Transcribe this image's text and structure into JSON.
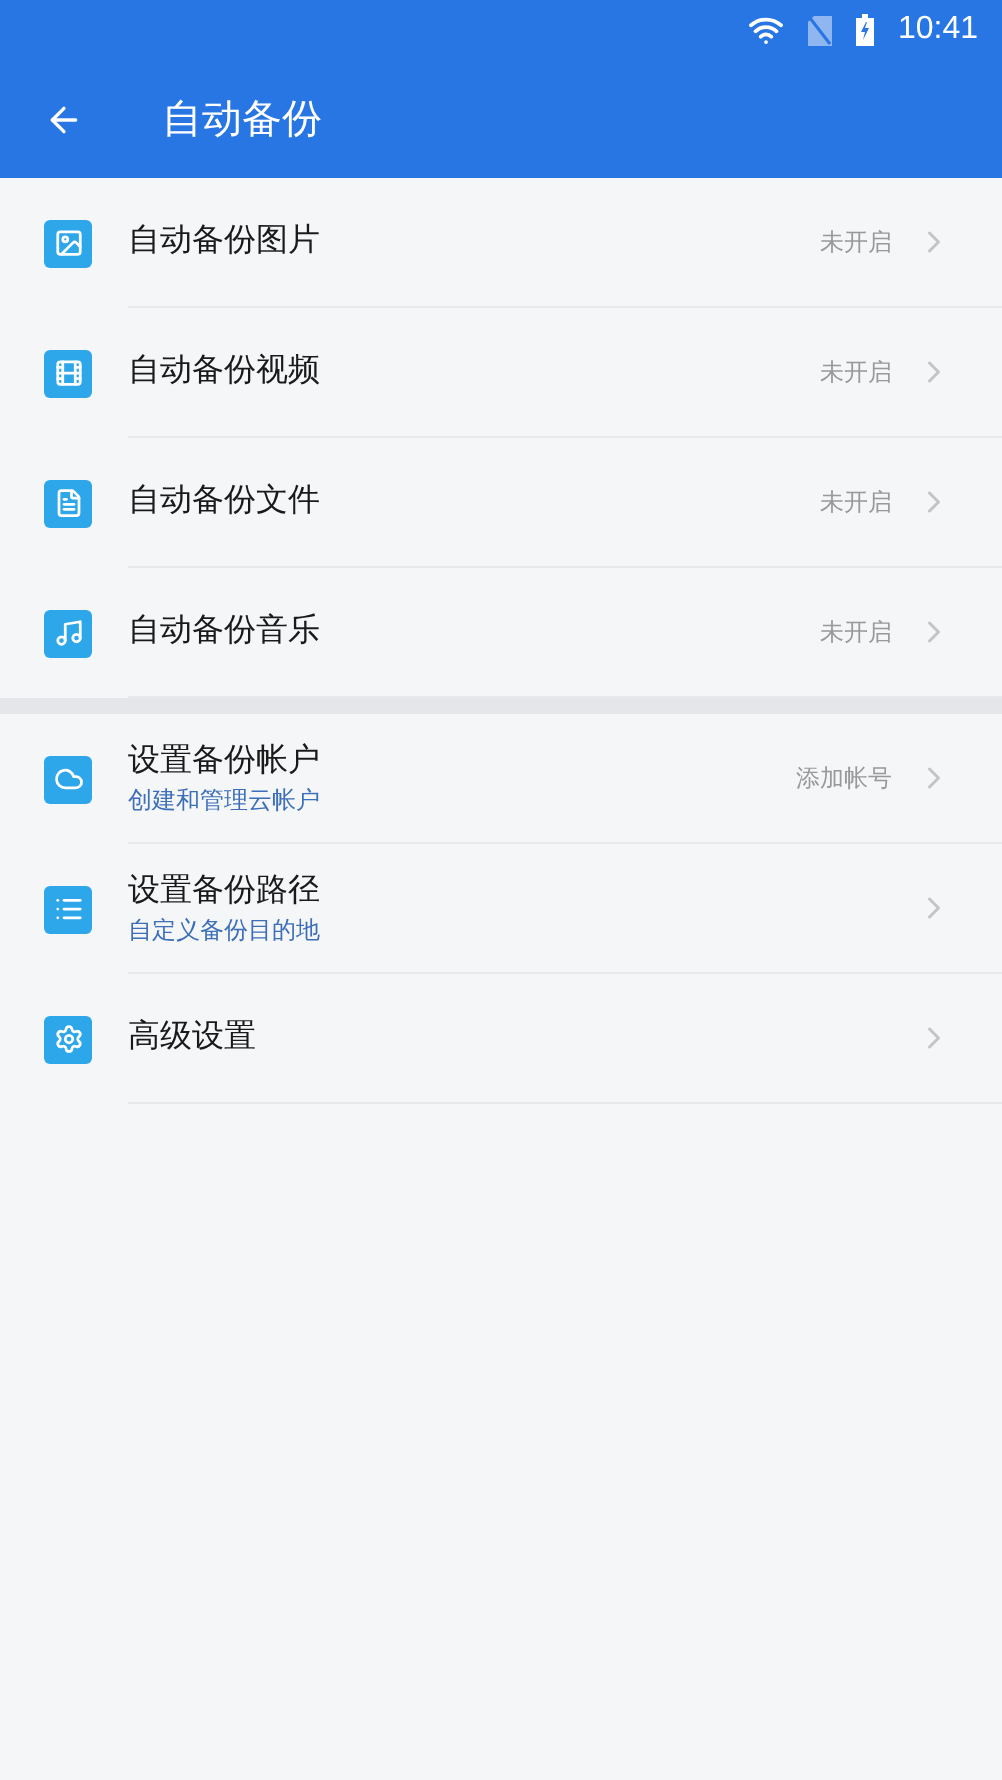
{
  "status_bar": {
    "time": "10:41"
  },
  "toolbar": {
    "title": "自动备份"
  },
  "sections": [
    {
      "items": [
        {
          "kind": "image",
          "title": "自动备份图片",
          "status": "未开启"
        },
        {
          "kind": "video",
          "title": "自动备份视频",
          "status": "未开启"
        },
        {
          "kind": "file",
          "title": "自动备份文件",
          "status": "未开启"
        },
        {
          "kind": "music",
          "title": "自动备份音乐",
          "status": "未开启"
        }
      ]
    },
    {
      "items": [
        {
          "kind": "cloud",
          "title": "设置备份帐户",
          "subtitle": "创建和管理云帐户",
          "status": "添加帐号"
        },
        {
          "kind": "list",
          "title": "设置备份路径",
          "subtitle": "自定义备份目的地"
        },
        {
          "kind": "gear",
          "title": "高级设置"
        }
      ]
    }
  ]
}
